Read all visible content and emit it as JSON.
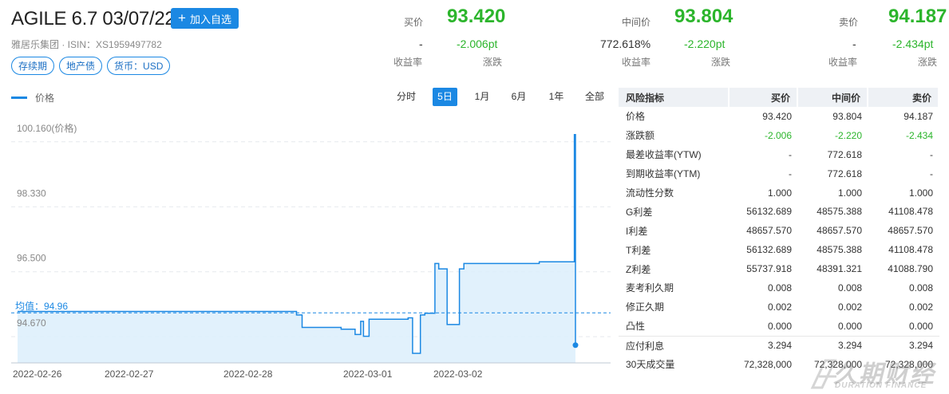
{
  "header": {
    "title": "AGILE 6.7 03/07/22",
    "add_label": "加入自选",
    "issuer": "雅居乐集团 · ISIN：XS1959497782",
    "tags": [
      "存续期",
      "地产债",
      "货币：USD"
    ]
  },
  "quotes": {
    "bid": {
      "label": "买价",
      "price": "93.420",
      "yield": "-",
      "yield_label": "收益率",
      "change": "-2.006pt",
      "change_label": "涨跌"
    },
    "mid": {
      "label": "中间价",
      "price": "93.804",
      "yield": "772.618%",
      "yield_label": "收益率",
      "change": "-2.220pt",
      "change_label": "涨跌"
    },
    "ask": {
      "label": "卖价",
      "price": "94.187",
      "yield": "-",
      "yield_label": "收益率",
      "change": "-2.434pt",
      "change_label": "涨跌"
    }
  },
  "chart_controls": {
    "legend": "价格",
    "periods": [
      "分时",
      "5日",
      "1月",
      "6月",
      "1年",
      "全部"
    ],
    "active_period": "5日"
  },
  "chart_data": {
    "type": "area",
    "series": [
      {
        "name": "价格"
      }
    ],
    "y_tick_labels": [
      "100.160(价格)",
      "98.330",
      "96.500",
      "94.670"
    ],
    "ylim": [
      93.55,
      100.56
    ],
    "x_tick_labels": [
      "2022-02-26",
      "2022-02-27",
      "2022-02-28",
      "2022-03-01",
      "2022-03-02"
    ],
    "average": {
      "label": "均值：94.96",
      "value": 94.96
    },
    "grid": true,
    "points": [
      [
        0.0,
        95.0
      ],
      [
        0.5,
        95.0
      ],
      [
        0.5,
        94.9
      ],
      [
        0.51,
        94.9
      ],
      [
        0.51,
        94.55
      ],
      [
        0.58,
        94.55
      ],
      [
        0.58,
        94.5
      ],
      [
        0.605,
        94.5
      ],
      [
        0.605,
        94.35
      ],
      [
        0.615,
        94.35
      ],
      [
        0.615,
        94.72
      ],
      [
        0.62,
        94.72
      ],
      [
        0.62,
        94.3
      ],
      [
        0.63,
        94.3
      ],
      [
        0.63,
        94.78
      ],
      [
        0.7,
        94.78
      ],
      [
        0.7,
        94.82
      ],
      [
        0.708,
        94.82
      ],
      [
        0.708,
        93.82
      ],
      [
        0.722,
        93.82
      ],
      [
        0.722,
        94.9
      ],
      [
        0.73,
        94.9
      ],
      [
        0.73,
        94.95
      ],
      [
        0.748,
        94.95
      ],
      [
        0.748,
        96.35
      ],
      [
        0.755,
        96.35
      ],
      [
        0.755,
        96.2
      ],
      [
        0.77,
        96.2
      ],
      [
        0.77,
        94.63
      ],
      [
        0.792,
        94.63
      ],
      [
        0.792,
        96.2
      ],
      [
        0.8,
        96.2
      ],
      [
        0.8,
        96.35
      ],
      [
        0.935,
        96.35
      ],
      [
        0.935,
        96.4
      ],
      [
        0.998,
        96.4
      ],
      [
        0.998,
        99.98
      ],
      [
        1.0,
        99.98
      ],
      [
        1.0,
        94.05
      ]
    ]
  },
  "risk_table": {
    "columns": [
      "风险指标",
      "买价",
      "中间价",
      "卖价"
    ],
    "rows": [
      {
        "name": "价格",
        "bid": "93.420",
        "mid": "93.804",
        "ask": "94.187"
      },
      {
        "name": "涨跌额",
        "bid": "-2.006",
        "mid": "-2.220",
        "ask": "-2.434",
        "green": true
      },
      {
        "name": "最差收益率(YTW)",
        "bid": "-",
        "mid": "772.618",
        "ask": "-"
      },
      {
        "name": "到期收益率(YTM)",
        "bid": "-",
        "mid": "772.618",
        "ask": "-"
      },
      {
        "name": "流动性分数",
        "bid": "1.000",
        "mid": "1.000",
        "ask": "1.000"
      },
      {
        "name": "G利差",
        "bid": "56132.689",
        "mid": "48575.388",
        "ask": "41108.478"
      },
      {
        "name": "I利差",
        "bid": "48657.570",
        "mid": "48657.570",
        "ask": "48657.570"
      },
      {
        "name": "T利差",
        "bid": "56132.689",
        "mid": "48575.388",
        "ask": "41108.478"
      },
      {
        "name": "Z利差",
        "bid": "55737.918",
        "mid": "48391.321",
        "ask": "41088.790"
      },
      {
        "name": "麦考利久期",
        "bid": "0.008",
        "mid": "0.008",
        "ask": "0.008"
      },
      {
        "name": "修正久期",
        "bid": "0.002",
        "mid": "0.002",
        "ask": "0.002"
      },
      {
        "name": "凸性",
        "bid": "0.000",
        "mid": "0.000",
        "ask": "0.000"
      },
      {
        "name": "应付利息",
        "bid": "3.294",
        "mid": "3.294",
        "ask": "3.294",
        "sep": true
      },
      {
        "name": "30天成交量",
        "bid": "72,328,000",
        "mid": "72,328,000",
        "ask": "72,328,000"
      }
    ]
  },
  "watermark": {
    "cn": "久期财经",
    "en": "DURATION FINANCE"
  },
  "colors": {
    "accent": "#1b88e3",
    "down": "#2cb52c",
    "area": "#dceefb"
  }
}
